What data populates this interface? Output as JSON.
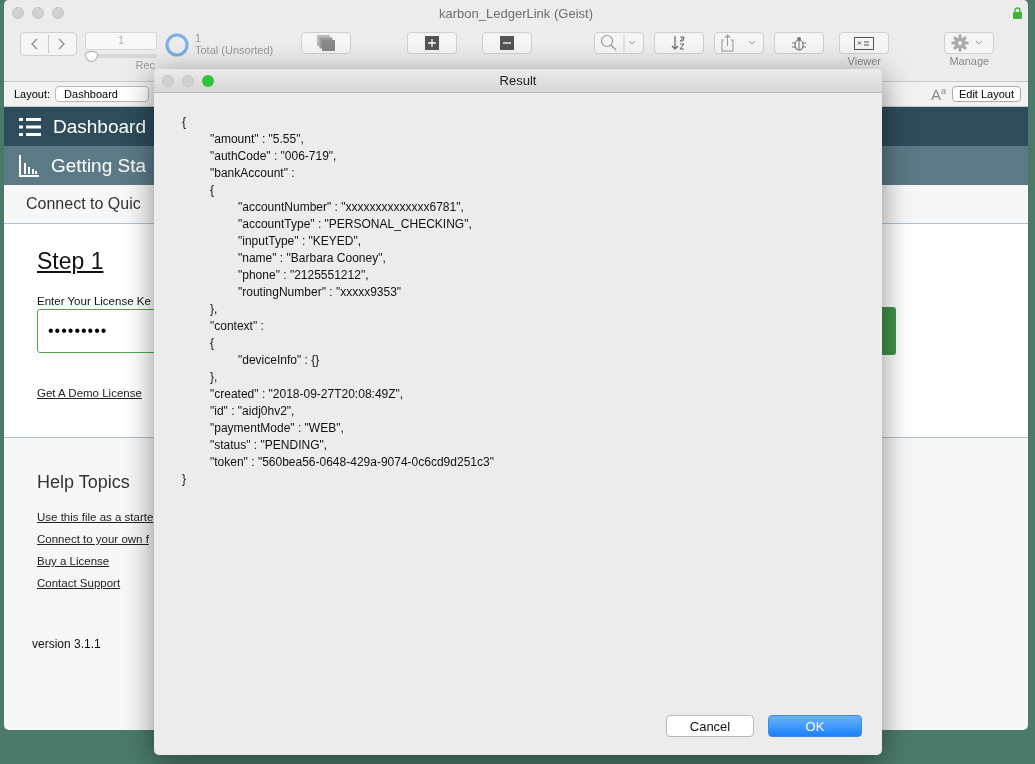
{
  "window": {
    "title": "karbon_LedgerLink (Geist)",
    "locked": true
  },
  "toolbar": {
    "record_value": "1",
    "record_slider": {
      "level": 0.08
    },
    "record_label": "Rec",
    "total_count": "1",
    "total_label": "Total (Unsorted)",
    "buttons": [
      {
        "kind": "show_all"
      },
      {
        "kind": "new"
      },
      {
        "kind": "delete"
      },
      {
        "kind": "find"
      },
      {
        "kind": "sort"
      },
      {
        "kind": "share"
      },
      {
        "kind": "debug"
      },
      {
        "kind": "viewer",
        "label": "Viewer"
      },
      {
        "kind": "manage",
        "label": "Manage"
      }
    ]
  },
  "layout_bar": {
    "label": "Layout:",
    "layout": "Dashboard",
    "text_size": "A$^{a}$",
    "edit_button": "Edit Layout"
  },
  "nav": [
    {
      "kind": "list",
      "label": "Dashboard"
    },
    {
      "kind": "chart",
      "label": "Getting Sta"
    }
  ],
  "breadcrumb": "Connect to Quic",
  "step": {
    "title": "Step 1",
    "license_label": "Enter Your License Ke",
    "license_value": "•••••••••",
    "demo_link": "Get A Demo License"
  },
  "help": {
    "title": "Help Topics",
    "links": [
      "Use this file as a starte",
      "Connect to your own f",
      "Buy a License",
      "Contact Support"
    ]
  },
  "version": "version 3.1.1",
  "dialog": {
    "title": "Result",
    "lines": [
      {
        "text": "{",
        "children": [
          {
            "text": "\"amount\" : \"5.55\","
          },
          {
            "text": "\"authCode\" : \"006-719\","
          },
          {
            "text": "\"bankAccount\" :"
          },
          {
            "text": "{",
            "children": [
              {
                "text": "\"accountNumber\" : \"xxxxxxxxxxxxxx6781\","
              },
              {
                "text": "\"accountType\" : \"PERSONAL_CHECKING\","
              },
              {
                "text": "\"inputType\" : \"KEYED\","
              },
              {
                "text": "\"name\" : \"Barbara Cooney\","
              },
              {
                "text": "\"phone\" : \"2125551212\","
              },
              {
                "text": "\"routingNumber\" : \"xxxxx9353\""
              }
            ]
          },
          {
            "text": "},"
          },
          {
            "text": "\"context\" :"
          },
          {
            "text": "{",
            "children": [
              {
                "text": "\"deviceInfo\" : {}"
              }
            ]
          },
          {
            "text": "},"
          },
          {
            "text": "\"created\" : \"2018-09-27T20:08:49Z\","
          },
          {
            "text": "\"id\" : \"aidj0hv2\","
          },
          {
            "text": "\"paymentMode\" : \"WEB\","
          },
          {
            "text": "\"status\" : \"PENDING\","
          },
          {
            "text": "\"token\" : \"560bea56-0648-429a-9074-0c6cd9d251c3\""
          }
        ]
      },
      {
        "text": "}"
      }
    ],
    "buttons": [
      {
        "label": "Cancel",
        "default": false
      },
      {
        "label": "OK",
        "default": true
      }
    ]
  }
}
